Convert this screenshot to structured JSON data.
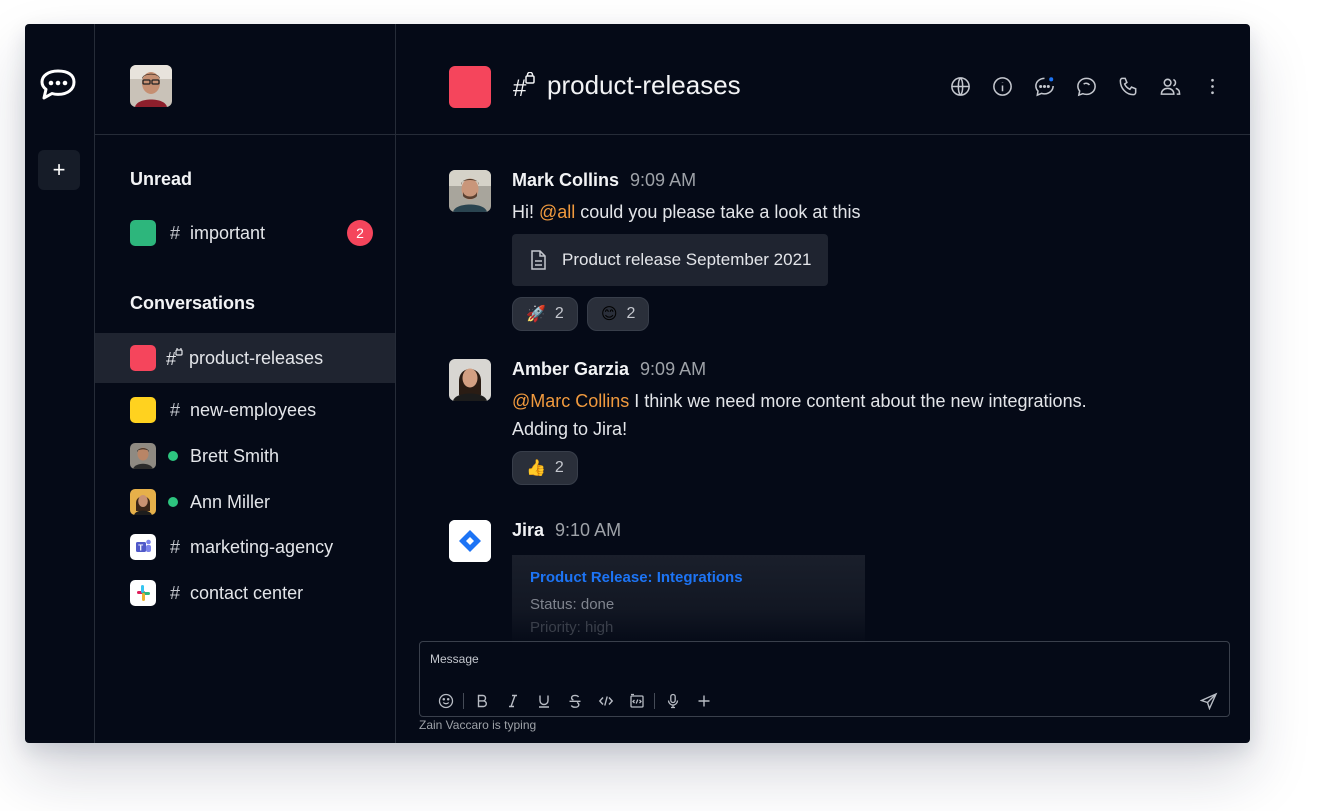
{
  "rail": {
    "add_label": "+"
  },
  "sidebar": {
    "sections": [
      {
        "title": "Unread"
      },
      {
        "title": "Conversations"
      }
    ],
    "unread_items": [
      {
        "label": "important",
        "color": "#2db67c",
        "badge": "2"
      }
    ],
    "conversation_items": [
      {
        "label": "product-releases",
        "color": "#f5455c",
        "kind": "channel-locked",
        "active": true
      },
      {
        "label": "new-employees",
        "color": "#ffd21f",
        "kind": "channel"
      },
      {
        "label": "Brett Smith",
        "kind": "user"
      },
      {
        "label": "Ann Miller",
        "kind": "user"
      },
      {
        "label": "marketing-agency",
        "kind": "teams"
      },
      {
        "label": "contact center",
        "kind": "slack"
      }
    ]
  },
  "header": {
    "room_title": "product-releases",
    "room_color": "#f5455c",
    "icons": [
      "globe-icon",
      "info-icon",
      "threads-icon",
      "discussion-icon",
      "phone-icon",
      "members-icon",
      "kebab-icon"
    ]
  },
  "messages": [
    {
      "author": "Mark Collins",
      "time": "9:09 AM",
      "text_prefix": "Hi! ",
      "mention": "@all",
      "text_suffix": " could you please take a look at this",
      "attachment": "Product release September 2021",
      "reactions": [
        {
          "emoji": "🚀",
          "count": "2"
        },
        {
          "emoji": "😊",
          "count": "2"
        }
      ]
    },
    {
      "author": "Amber Garzia",
      "time": "9:09 AM",
      "mention": "@Marc Collins",
      "text_suffix": " I think we need more content about the new integrations.",
      "text_line2": "Adding to Jira!",
      "reactions": [
        {
          "emoji": "👍",
          "count": "2"
        }
      ]
    },
    {
      "author": "Jira",
      "time": "9:10 AM",
      "card": {
        "title": "Product Release: Integrations",
        "status": "Status: done",
        "priority": "Priority: high"
      }
    }
  ],
  "composer": {
    "placeholder": "Message",
    "tools": [
      "emoji-icon",
      "bold-icon",
      "italic-icon",
      "underline-icon",
      "strikethrough-icon",
      "code-icon",
      "code-block-icon",
      "mic-icon",
      "plus-icon"
    ],
    "typing": "Zain Vaccaro is typing"
  },
  "colors": {
    "background": "#050a17",
    "accent": "#1d74f5",
    "mention": "#f19a3e",
    "badge": "#f5455c"
  }
}
